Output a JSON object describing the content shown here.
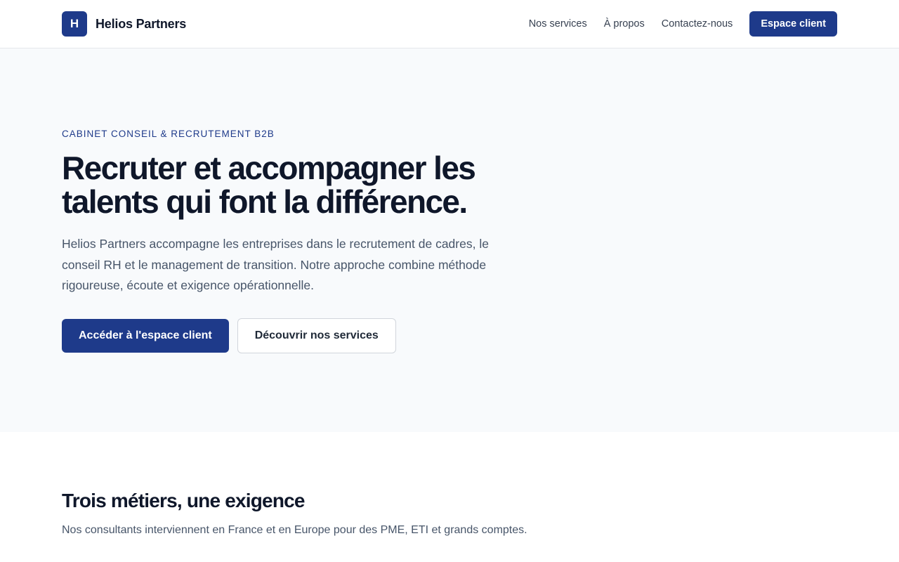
{
  "header": {
    "logo_letter": "H",
    "brand_name": "Helios Partners",
    "nav": [
      {
        "label": "Nos services"
      },
      {
        "label": "À propos"
      },
      {
        "label": "Contactez-nous"
      }
    ],
    "cta_label": "Espace client"
  },
  "hero": {
    "eyebrow": "CABINET CONSEIL & RECRUTEMENT B2B",
    "title": "Recruter et accompagner les talents qui font la différence.",
    "lead": "Helios Partners accompagne les entreprises dans le recrutement de cadres, le conseil RH et le management de transition. Notre approche combine méthode rigoureuse, écoute et exigence opérationnelle.",
    "primary_button": "Accéder à l'espace client",
    "secondary_button": "Découvrir nos services"
  },
  "services": {
    "title": "Trois métiers, une exigence",
    "subtitle": "Nos consultants interviennent en France et en Europe pour des PME, ETI et grands comptes."
  },
  "colors": {
    "brand": "#1e3a8a",
    "hero_background": "#f8fafc",
    "text_primary": "#0f172a",
    "text_secondary": "#475569"
  }
}
